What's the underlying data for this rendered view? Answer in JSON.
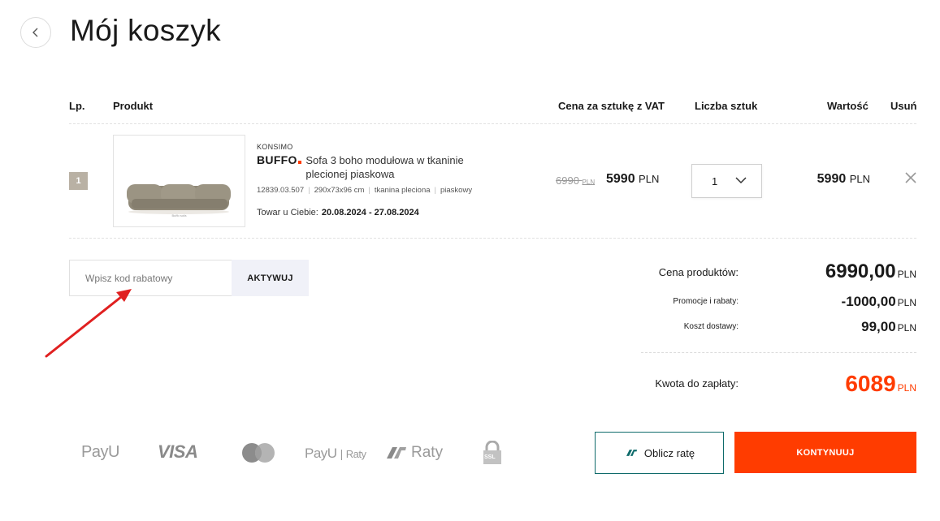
{
  "page": {
    "title": "Mój koszyk"
  },
  "table": {
    "headers": {
      "lp": "Lp.",
      "product": "Produkt",
      "unit_price": "Cena za sztukę z VAT",
      "quantity": "Liczba sztuk",
      "value": "Wartość",
      "remove": "Usuń"
    },
    "rows": [
      {
        "lp": "1",
        "image_caption": "Buffo sofa",
        "brand": "KONSIMO",
        "name": "BUFFO",
        "description": "Sofa 3 boho modułowa w tkaninie plecionej piaskowa",
        "sku": "12839.03.507",
        "dimensions": "290x73x96 cm",
        "material": "tkanina pleciona",
        "color_name": "piaskowy",
        "delivery_label": "Towar u Ciebie:",
        "delivery_dates": "20.08.2024 - 27.08.2024",
        "old_price": "6990",
        "old_price_currency": "PLN",
        "price": "5990",
        "price_currency": "PLN",
        "quantity": "1",
        "value": "5990",
        "value_currency": "PLN"
      }
    ]
  },
  "coupon": {
    "placeholder": "Wpisz kod rabatowy",
    "value": "",
    "button_label": "AKTYWUJ"
  },
  "summary": {
    "products_label": "Cena produktów:",
    "products_value": "6990,00",
    "promo_label": "Promocje i rabaty:",
    "promo_value": "-1000,00",
    "shipping_label": "Koszt dostawy:",
    "shipping_value": "99,00",
    "total_label": "Kwota do zapłaty:",
    "total_value": "6089",
    "currency": "PLN"
  },
  "payments": {
    "payu": "PayU",
    "visa": "VISA",
    "mastercard": "mastercard-icon",
    "payu_raty_brand": "PayU",
    "payu_raty_label": "Raty",
    "ca_raty": "Raty",
    "ssl": "SSL"
  },
  "actions": {
    "calc_label": "Oblicz ratę",
    "continue_label": "KONTYNUUJ"
  },
  "colors": {
    "accent": "#ff3c00",
    "teal_border": "#0f6b6b",
    "badge": "#b9b1a4",
    "coupon_btn_bg": "#f0f1f8",
    "annotation_arrow": "#e02020"
  }
}
